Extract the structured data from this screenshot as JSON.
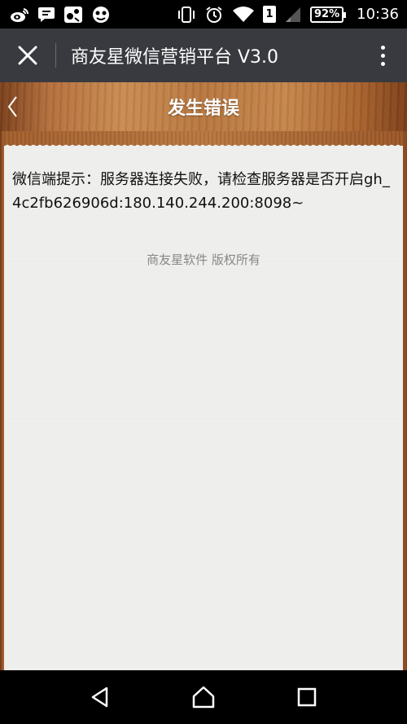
{
  "status_bar": {
    "battery": "92%",
    "time": "10:36",
    "sim": "1"
  },
  "app_bar": {
    "title": "商友星微信营销平台 V3.0"
  },
  "header": {
    "title": "发生错误"
  },
  "content": {
    "error_message": "微信端提示：服务器连接失败，请检查服务器是否开启gh_4c2fb626906d:180.140.244.200:8098~",
    "copyright": "商友星软件 版权所有"
  },
  "icons": {
    "status_left": [
      "weibo-icon",
      "chat-bubble-icon",
      "game-icon",
      "emoji-icon"
    ],
    "status_right": [
      "vibrate-icon",
      "alarm-icon",
      "wifi-icon",
      "sim-icon",
      "signal-icon",
      "battery-icon"
    ],
    "nav": [
      "back-triangle-icon",
      "home-icon",
      "recents-square-icon"
    ]
  },
  "colors": {
    "app_bar_bg": "#393a3f",
    "wood": "#b8763e",
    "paper": "#efefed"
  }
}
